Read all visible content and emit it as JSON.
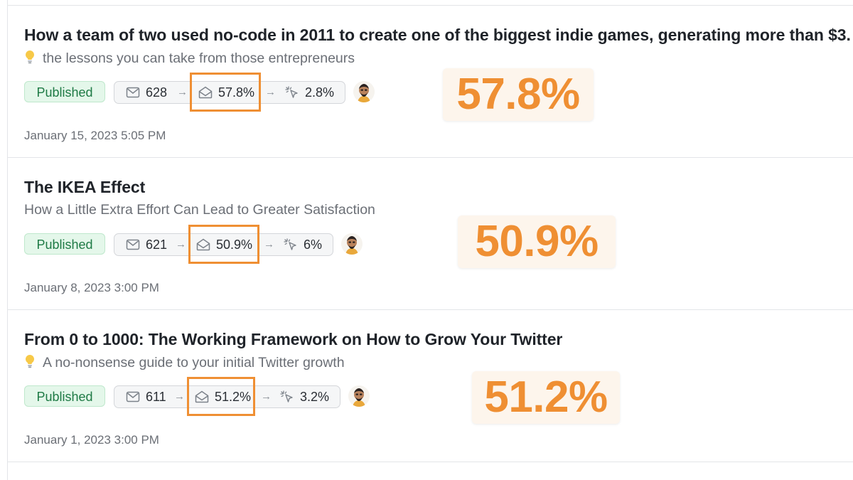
{
  "theme": {
    "accent": "#ef8f33",
    "published_bg": "#e4f7ea",
    "published_text": "#1e7a45"
  },
  "posts": [
    {
      "title": "How a team of two used no-code in 2011 to create one of the biggest indie games, generating more than $3.",
      "subtitle": "the lessons you can take from those entrepreneurs",
      "subtitle_icon": "lightbulb-icon",
      "status": "Published",
      "recipients": "628",
      "open_rate": "57.8%",
      "click_rate": "2.8%",
      "date": "January 15, 2023 5:05 PM",
      "callout": "57.8%"
    },
    {
      "title": "The IKEA Effect",
      "subtitle": "How a Little Extra Effort Can Lead to Greater Satisfaction",
      "subtitle_icon": "",
      "status": "Published",
      "recipients": "621",
      "open_rate": "50.9%",
      "click_rate": "6%",
      "date": "January 8, 2023 3:00 PM",
      "callout": "50.9%"
    },
    {
      "title": "From 0 to 1000: The Working Framework on How to Grow Your Twitter",
      "subtitle": "A no-nonsense guide to your initial Twitter growth",
      "subtitle_icon": "lightbulb-icon",
      "status": "Published",
      "recipients": "611",
      "open_rate": "51.2%",
      "click_rate": "3.2%",
      "date": "January 1, 2023 3:00 PM",
      "callout": "51.2%"
    }
  ],
  "icons": {
    "recipients": "mail-icon",
    "opens": "open-envelope-icon",
    "clicks": "cursor-click-icon",
    "flow": "arrow-right-icon",
    "author": "author-avatar"
  }
}
